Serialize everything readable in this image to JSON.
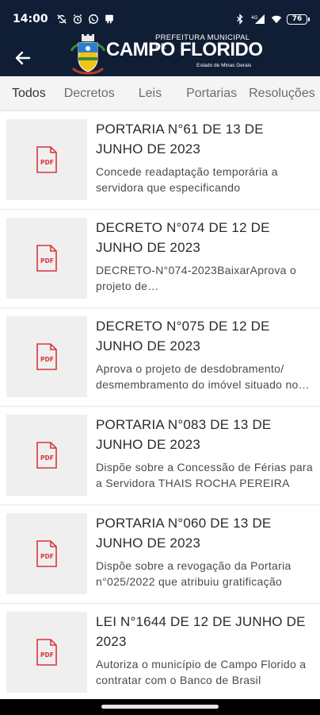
{
  "status_bar": {
    "time": "14:00",
    "icons_left": [
      "sync-off-icon",
      "alarm-icon",
      "whatsapp-icon",
      "app-notification-icon"
    ],
    "icons_right": [
      "bluetooth-icon",
      "cellular-4g-icon",
      "wifi-icon",
      "battery-icon"
    ],
    "signal_label": "4G",
    "battery_level": "76"
  },
  "header": {
    "back_icon": "arrow-left-icon",
    "logo": {
      "top_text": "PREFEITURA MUNICIPAL DE",
      "main_text": "CAMPO FLORIDO",
      "sub_text": "Estado de Minas Gerais"
    },
    "background_color": "#101e35"
  },
  "tabs": [
    {
      "label": "Todos",
      "active": true
    },
    {
      "label": "Decretos",
      "active": false
    },
    {
      "label": "Leis",
      "active": false
    },
    {
      "label": "Portarias",
      "active": false
    },
    {
      "label": "Resoluções",
      "active": false
    }
  ],
  "documents": [
    {
      "title": "PORTARIA N°61 DE 13 DE JUNHO DE 2023",
      "description": "Concede readaptação temporária a servidora que especificando",
      "thumbnail_icon": "pdf-file-icon"
    },
    {
      "title": "DECRETO N°074 DE 12 DE JUNHO DE 2023",
      "description": "DECRETO-N°074-2023BaixarAprova o projeto de desdobramento/desmembramento",
      "thumbnail_icon": "pdf-file-icon"
    },
    {
      "title": "DECRETO N°075 DE 12 DE JUNHO DE 2023",
      "description": "Aprova o projeto de desdobramento/ desmembramento do imóvel situado no município",
      "thumbnail_icon": "pdf-file-icon"
    },
    {
      "title": "PORTARIA N°083 DE 13 DE JUNHO DE 2023",
      "description": "Dispõe sobre a Concessão de Férias para a Servidora THAIS ROCHA PEREIRA",
      "thumbnail_icon": "pdf-file-icon"
    },
    {
      "title": "PORTARIA N°060 DE 13 DE JUNHO DE 2023",
      "description": "Dispõe sobre a revogação da Portaria n°025/2022 que atribuiu gratificação",
      "thumbnail_icon": "pdf-file-icon"
    },
    {
      "title": "LEI N°1644 DE 12 DE JUNHO DE 2023",
      "description": "Autoriza o município de Campo Florido a contratar com o Banco de Brasil",
      "thumbnail_icon": "pdf-file-icon"
    }
  ],
  "pdf_label": "PDF",
  "colors": {
    "accent_pdf": "#d9373d",
    "thumb_bg": "#efefef",
    "tabs_bg": "#f4f4f4"
  }
}
